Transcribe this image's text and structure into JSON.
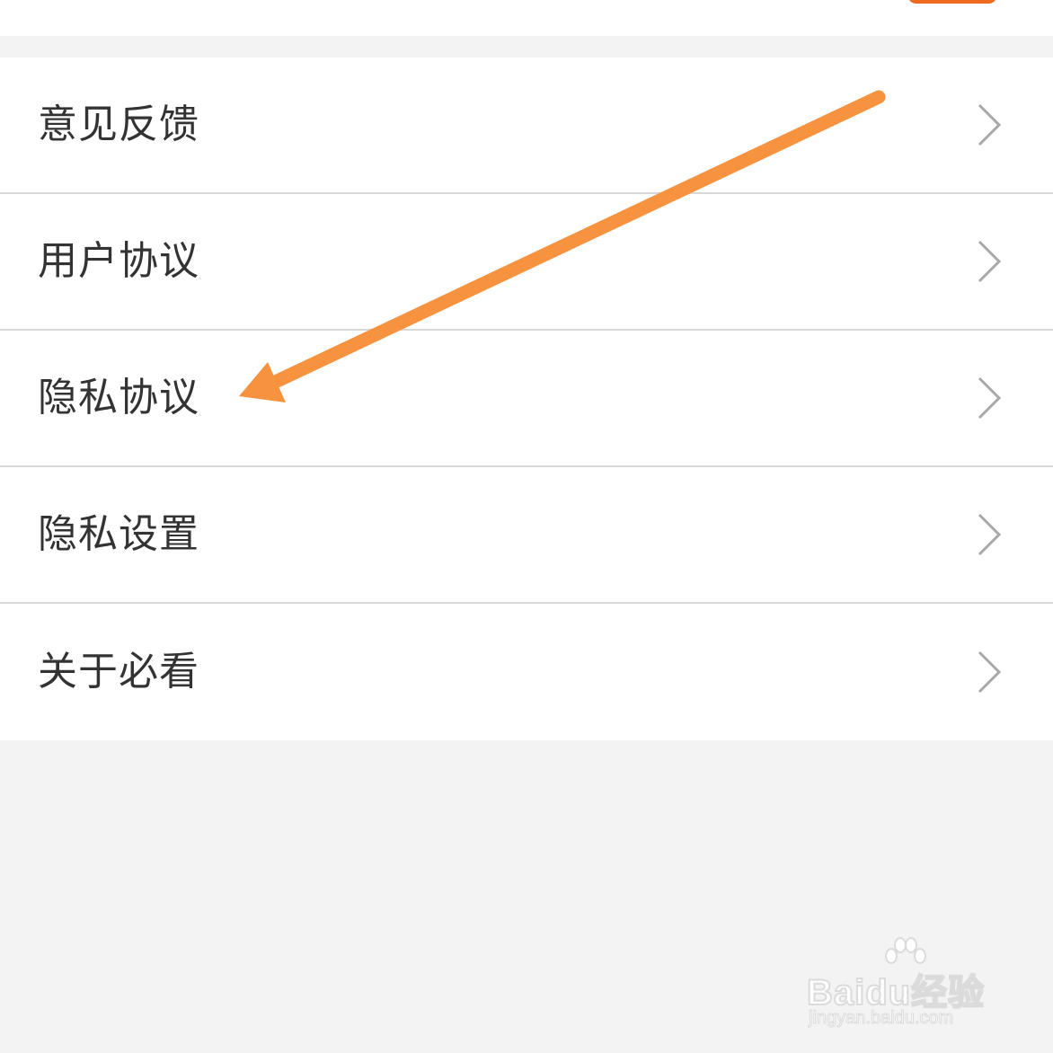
{
  "menu": {
    "items": [
      {
        "label": "意见反馈"
      },
      {
        "label": "用户协议"
      },
      {
        "label": "隐私协议"
      },
      {
        "label": "隐私设置"
      },
      {
        "label": "关于必看"
      }
    ]
  },
  "annotation": {
    "color": "#f7923f",
    "target": "隐私协议"
  },
  "watermark": {
    "logo": "Baidu经验",
    "url": "jingyan.baidu.com"
  },
  "colors": {
    "background": "#f3f3f3",
    "divider": "#d8d8d8",
    "text": "#333333",
    "chevron": "#a8a8a8",
    "accent": "#ee6a21"
  },
  "icons": {
    "chevron": "chevron-right-icon",
    "arrow": "arrow-annotation-icon",
    "paw": "baidu-paw-icon"
  }
}
